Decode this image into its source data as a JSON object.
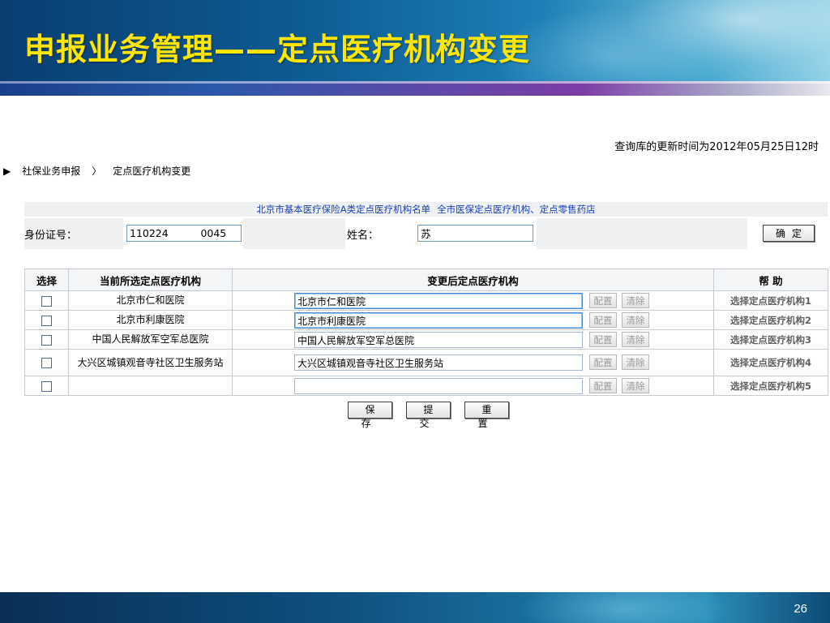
{
  "slide": {
    "title": "申报业务管理——定点医疗机构变更",
    "page_number": "26"
  },
  "update_time": "查询库的更新时间为2012年05月25日12时",
  "breadcrumb": {
    "arrow": "▶",
    "section": "社保业务申报",
    "separator": "〉",
    "current": "定点医疗机构变更"
  },
  "links": {
    "list_a": "北京市基本医疗保险A类定点医疗机构名单",
    "list_all": "全市医保定点医疗机构、定点零售药店"
  },
  "form": {
    "id_label": "身份证号：",
    "id_value": "110224          0045",
    "name_label": "姓名：",
    "name_value": "苏",
    "confirm_label": "确定"
  },
  "table": {
    "headers": {
      "select": "选择",
      "current": "当前所选定点医疗机构",
      "changed": "变更后定点医疗机构",
      "help": "帮 助"
    },
    "config_label": "配置",
    "clear_label": "清除",
    "rows": [
      {
        "current": "北京市仁和医院",
        "new": "北京市仁和医院",
        "help": "选择定点医疗机构1",
        "active": true
      },
      {
        "current": "北京市利康医院",
        "new": "北京市利康医院",
        "help": "选择定点医疗机构2",
        "active": true
      },
      {
        "current": "中国人民解放军空军总医院",
        "new": "中国人民解放军空军总医院",
        "help": "选择定点医疗机构3",
        "active": false
      },
      {
        "current": "大兴区城镇观音寺社区卫生服务站",
        "new": "大兴区城镇观音寺社区卫生服务站",
        "help": "选择定点医疗机构4",
        "active": false
      },
      {
        "current": "",
        "new": "",
        "help": "选择定点医疗机构5",
        "active": false
      }
    ]
  },
  "actions": {
    "save": "保存",
    "submit": "提交",
    "reset": "重置"
  }
}
